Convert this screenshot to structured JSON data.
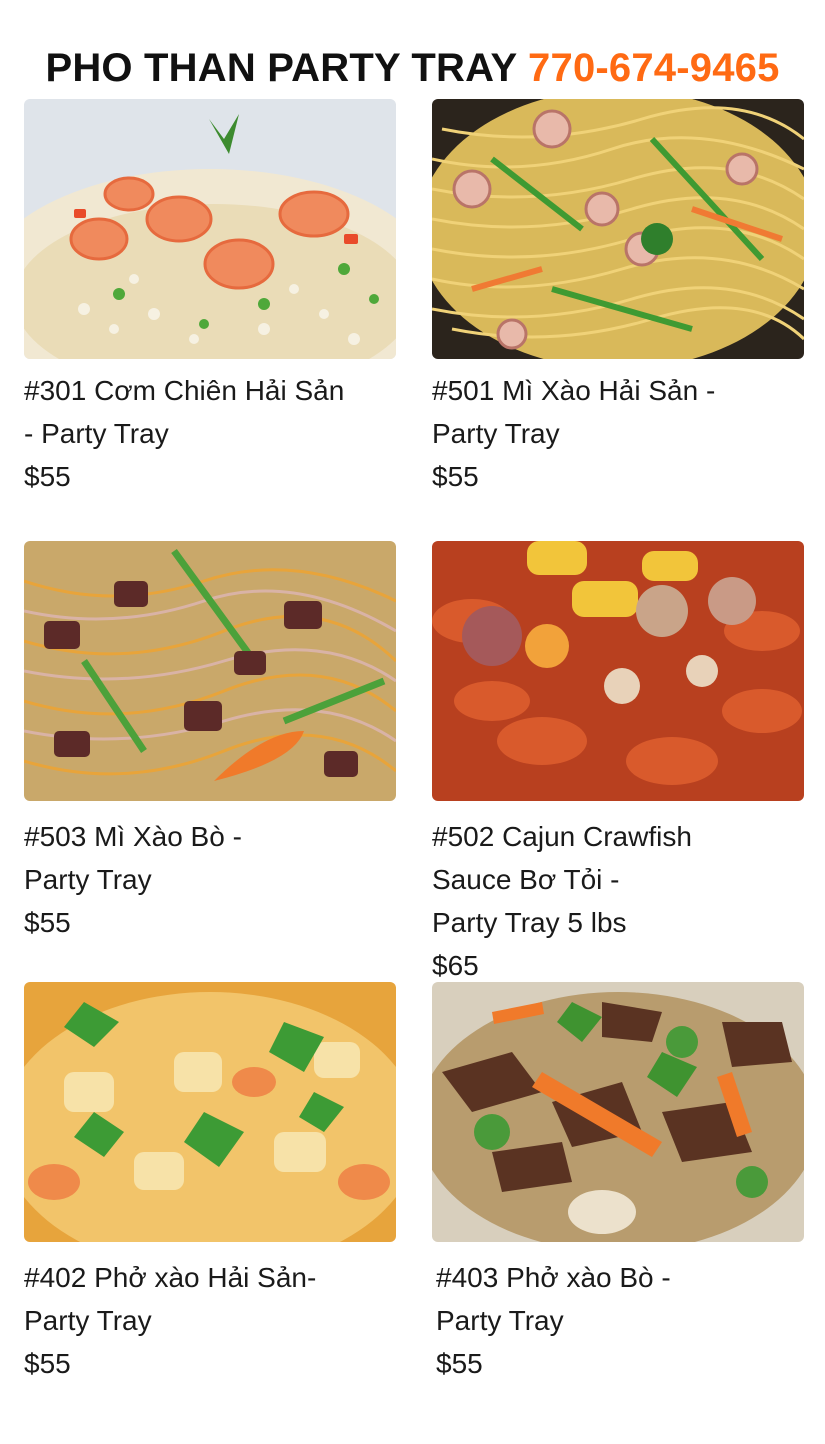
{
  "header": {
    "title": "PHO THAN PARTY TRAY",
    "phone": "770-674-9465"
  },
  "items": [
    {
      "lines": [
        "#301 Cơm Chiên Hải Sản",
        "- Party Tray"
      ],
      "price": "$55",
      "photo": "fried-rice-shrimp"
    },
    {
      "lines": [
        "#501 Mì Xào Hải Sản -",
        "Party Tray"
      ],
      "price": "$55",
      "photo": "seafood-noodles"
    },
    {
      "lines": [
        "#503 Mì Xào Bò -",
        "Party Tray"
      ],
      "price": "$55",
      "photo": "beef-noodles"
    },
    {
      "lines": [
        "#502 Cajun Crawfish",
        "Sauce Bơ Tỏi  -",
        "Party Tray 5 lbs"
      ],
      "price": "$65",
      "photo": "cajun-crawfish"
    },
    {
      "lines": [
        "#402 Phở xào Hải Sản-",
        "Party Tray"
      ],
      "price": "$55",
      "photo": "seafood-stirfry"
    },
    {
      "lines": [
        "#403 Phở xào Bò -",
        "Party Tray"
      ],
      "price": "$55",
      "photo": "beef-stirfry"
    }
  ]
}
